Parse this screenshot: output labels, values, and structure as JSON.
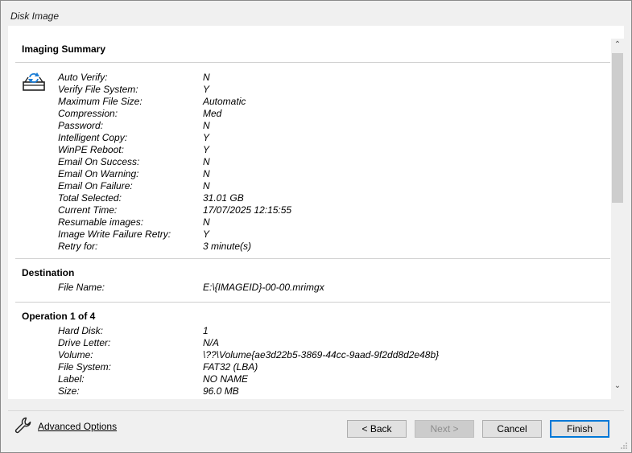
{
  "window": {
    "title": "Disk Image"
  },
  "summary": {
    "title": "Imaging Summary",
    "icon": "disk-image-icon",
    "rows": [
      {
        "key": "Auto Verify:",
        "value": "N"
      },
      {
        "key": "Verify File System:",
        "value": "Y"
      },
      {
        "key": "Maximum File Size:",
        "value": "Automatic"
      },
      {
        "key": "Compression:",
        "value": "Med"
      },
      {
        "key": "Password:",
        "value": "N"
      },
      {
        "key": "Intelligent Copy:",
        "value": "Y"
      },
      {
        "key": "WinPE Reboot:",
        "value": "Y"
      },
      {
        "key": "Email On Success:",
        "value": "N"
      },
      {
        "key": "Email On Warning:",
        "value": "N"
      },
      {
        "key": "Email On Failure:",
        "value": "N"
      },
      {
        "key": "Total Selected:",
        "value": "31.01 GB"
      },
      {
        "key": "Current Time:",
        "value": "17/07/2025 12:15:55"
      },
      {
        "key": "Resumable images:",
        "value": "N"
      },
      {
        "key": "Image Write Failure Retry:",
        "value": "Y"
      },
      {
        "key": "Retry for:",
        "value": "3 minute(s)"
      }
    ]
  },
  "destination": {
    "title": "Destination",
    "rows": [
      {
        "key": "File Name:",
        "value": "E:\\{IMAGEID}-00-00.mrimgx"
      }
    ]
  },
  "operation": {
    "title": "Operation 1 of 4",
    "rows": [
      {
        "key": "Hard Disk:",
        "value": "1"
      },
      {
        "key": "Drive Letter:",
        "value": "N/A"
      },
      {
        "key": "Volume:",
        "value": "\\??\\Volume{ae3d22b5-3869-44cc-9aad-9f2dd8d2e48b}"
      },
      {
        "key": "File System:",
        "value": "FAT32 (LBA)"
      },
      {
        "key": "Label:",
        "value": "NO NAME"
      },
      {
        "key": "Size:",
        "value": "96.0 MB"
      }
    ]
  },
  "footer": {
    "advanced_label": "Advanced Options",
    "back_label": "< Back",
    "next_label": "Next >",
    "cancel_label": "Cancel",
    "finish_label": "Finish"
  },
  "colors": {
    "accent": "#0078d7",
    "window_bg": "#f0f0f0",
    "content_bg": "#ffffff"
  }
}
